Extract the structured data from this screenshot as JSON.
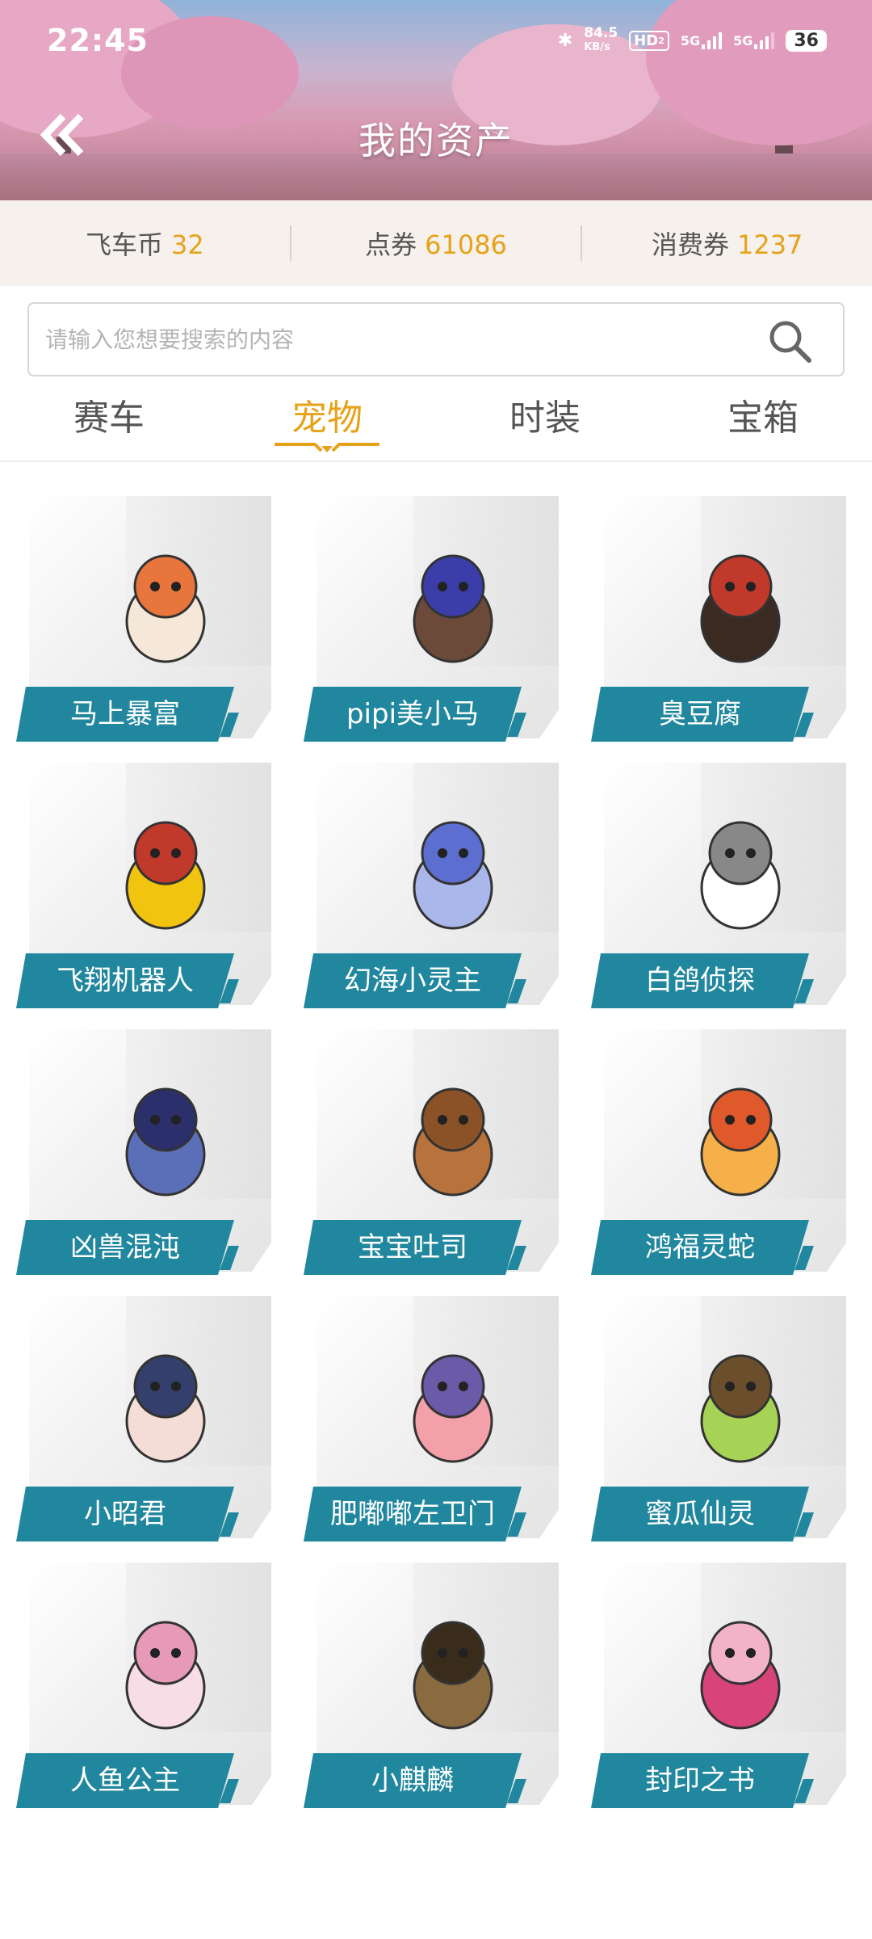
{
  "status_bar": {
    "time": "22:45",
    "net_speed_value": "84.5",
    "net_speed_unit": "KB/s",
    "hd": "HD",
    "hd_sub": "2",
    "sig1": "5G",
    "sig2": "5G",
    "battery": "36"
  },
  "header": {
    "title": "我的资产"
  },
  "currency": [
    {
      "label": "飞车币",
      "value": "32"
    },
    {
      "label": "点券",
      "value": "61086"
    },
    {
      "label": "消费券",
      "value": "1237"
    }
  ],
  "search": {
    "placeholder": "请输入您想要搜索的内容"
  },
  "tabs": [
    {
      "label": "赛车"
    },
    {
      "label": "宠物"
    },
    {
      "label": "时装"
    },
    {
      "label": "宝箱"
    }
  ],
  "active_tab": "宠物",
  "pets": [
    {
      "name": "马上暴富"
    },
    {
      "name": "pipi美小马"
    },
    {
      "name": "臭豆腐"
    },
    {
      "name": "飞翔机器人"
    },
    {
      "name": "幻海小灵主"
    },
    {
      "name": "白鸽侦探"
    },
    {
      "name": "凶兽混沌"
    },
    {
      "name": "宝宝吐司"
    },
    {
      "name": "鸿福灵蛇"
    },
    {
      "name": "小昭君"
    },
    {
      "name": "肥嘟嘟左卫门"
    },
    {
      "name": "蜜瓜仙灵"
    },
    {
      "name": "人鱼公主"
    },
    {
      "name": "小麒麟"
    },
    {
      "name": "封印之书"
    }
  ],
  "colors": {
    "accent": "#e6a219",
    "label_bg": "#21879e"
  }
}
